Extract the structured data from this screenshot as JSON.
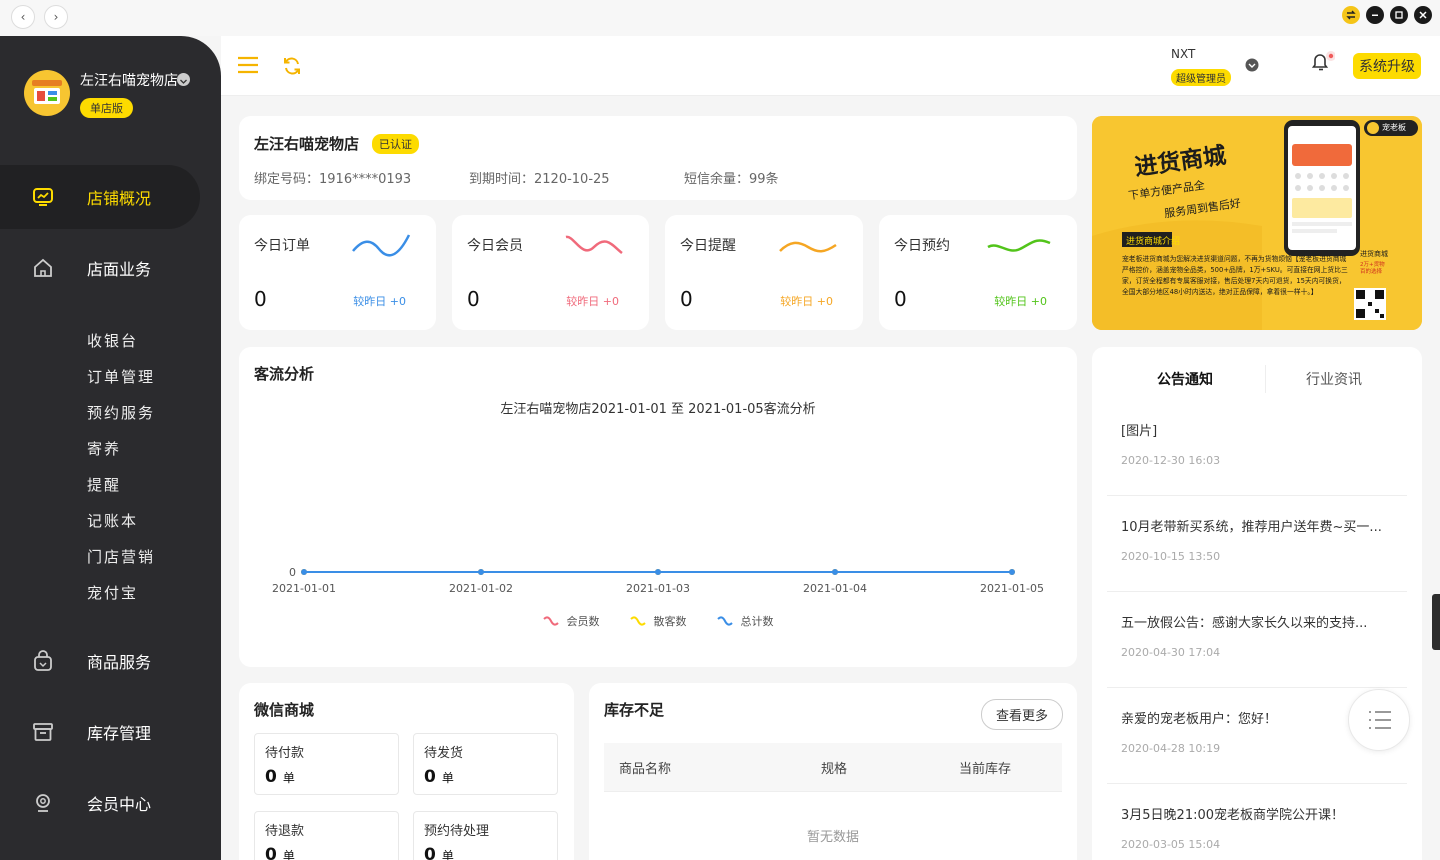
{
  "window": {
    "back": "‹",
    "forward": "›"
  },
  "sidebar": {
    "shop_name": "左汪右喵宠物店",
    "edition": "单店版",
    "main_items": [
      {
        "label": "店铺概况",
        "icon": "monitor-icon"
      },
      {
        "label": "店面业务",
        "icon": "home-icon"
      },
      {
        "label": "商品服务",
        "icon": "bag-icon"
      },
      {
        "label": "库存管理",
        "icon": "box-icon"
      },
      {
        "label": "会员中心",
        "icon": "member-icon"
      }
    ],
    "sub_items": [
      "收银台",
      "订单管理",
      "预约服务",
      "寄养",
      "提醒",
      "记账本",
      "门店营销",
      "宠付宝"
    ]
  },
  "header": {
    "user_name": "NXT",
    "role": "超级管理员",
    "upgrade_label": "系统升级"
  },
  "store_info": {
    "name": "左汪右喵宠物店",
    "verified": "已认证",
    "phone": "绑定号码：1916****0193",
    "expiry": "到期时间：2120-10-25",
    "sms": "短信余量：99条"
  },
  "stats": [
    {
      "label": "今日订单",
      "value": "0",
      "compare": "较昨日 +0",
      "color": "#3a8ee6"
    },
    {
      "label": "今日会员",
      "value": "0",
      "compare": "较昨日 +0",
      "color": "#f06a7b"
    },
    {
      "label": "今日提醒",
      "value": "0",
      "compare": "较昨日 +0",
      "color": "#f5a623"
    },
    {
      "label": "今日预约",
      "value": "0",
      "compare": "较昨日 +0",
      "color": "#52c41a"
    }
  ],
  "traffic": {
    "title": "客流分析",
    "chart_title": "左汪右喵宠物店2021-01-01 至 2021-01-05客流分析"
  },
  "chart_data": {
    "type": "line",
    "title": "左汪右喵宠物店2021-01-01 至 2021-01-05客流分析",
    "x": [
      "2021-01-01",
      "2021-01-02",
      "2021-01-03",
      "2021-01-04",
      "2021-01-05"
    ],
    "series": [
      {
        "name": "会员数",
        "values": [
          0,
          0,
          0,
          0,
          0
        ],
        "color": "#f06a7b"
      },
      {
        "name": "散客数",
        "values": [
          0,
          0,
          0,
          0,
          0
        ],
        "color": "#fddb00"
      },
      {
        "name": "总计数",
        "values": [
          0,
          0,
          0,
          0,
          0
        ],
        "color": "#3a8ee6"
      }
    ],
    "y_tick": "0",
    "legend": "bottom"
  },
  "wechat_mall": {
    "title": "微信商城",
    "unit": "单",
    "boxes": [
      {
        "label": "待付款",
        "value": "0"
      },
      {
        "label": "待发货",
        "value": "0"
      },
      {
        "label": "待退款",
        "value": "0"
      },
      {
        "label": "预约待处理",
        "value": "0"
      }
    ]
  },
  "low_stock": {
    "title": "库存不足",
    "more": "查看更多",
    "columns": [
      "商品名称",
      "规格",
      "当前库存"
    ],
    "empty": "暂无数据"
  },
  "notices": {
    "tabs": [
      "公告通知",
      "行业资讯"
    ],
    "items": [
      {
        "title": "[图片]",
        "date": "2020-12-30 16:03"
      },
      {
        "title": "10月老带新买系统，推荐用户送年费~买一...",
        "date": "2020-10-15 13:50"
      },
      {
        "title": "五一放假公告：感谢大家长久以来的支持...",
        "date": "2020-04-30 17:04"
      },
      {
        "title": "亲爱的宠老板用户：您好！",
        "date": "2020-04-28 10:19"
      },
      {
        "title": "3月5日晚21:00宠老板商学院公开课！",
        "date": "2020-03-05 15:04"
      }
    ]
  },
  "banner": {
    "headline": "进货商城",
    "sub1": "下单方便产品全",
    "sub2": "服务周到售后好",
    "intro_title": "进货商城介绍",
    "intro_text": "宠老板进货商城为您解决进货渠道问题，不再为货物烦恼【宠老板进货商城严格控价，涵盖宠物全品类，500+品牌，1万+SKU。可直接在网上货比三家，订货全程都有专属客服对接，售后处理7天内可退货，15天内可换货，全国大部分地区48小时内送达，绝对正品保障，拿着很一样十。】",
    "badge": "宠老板",
    "side_text": "进货商城",
    "side_sub": "2万+货物\n百的选择"
  }
}
